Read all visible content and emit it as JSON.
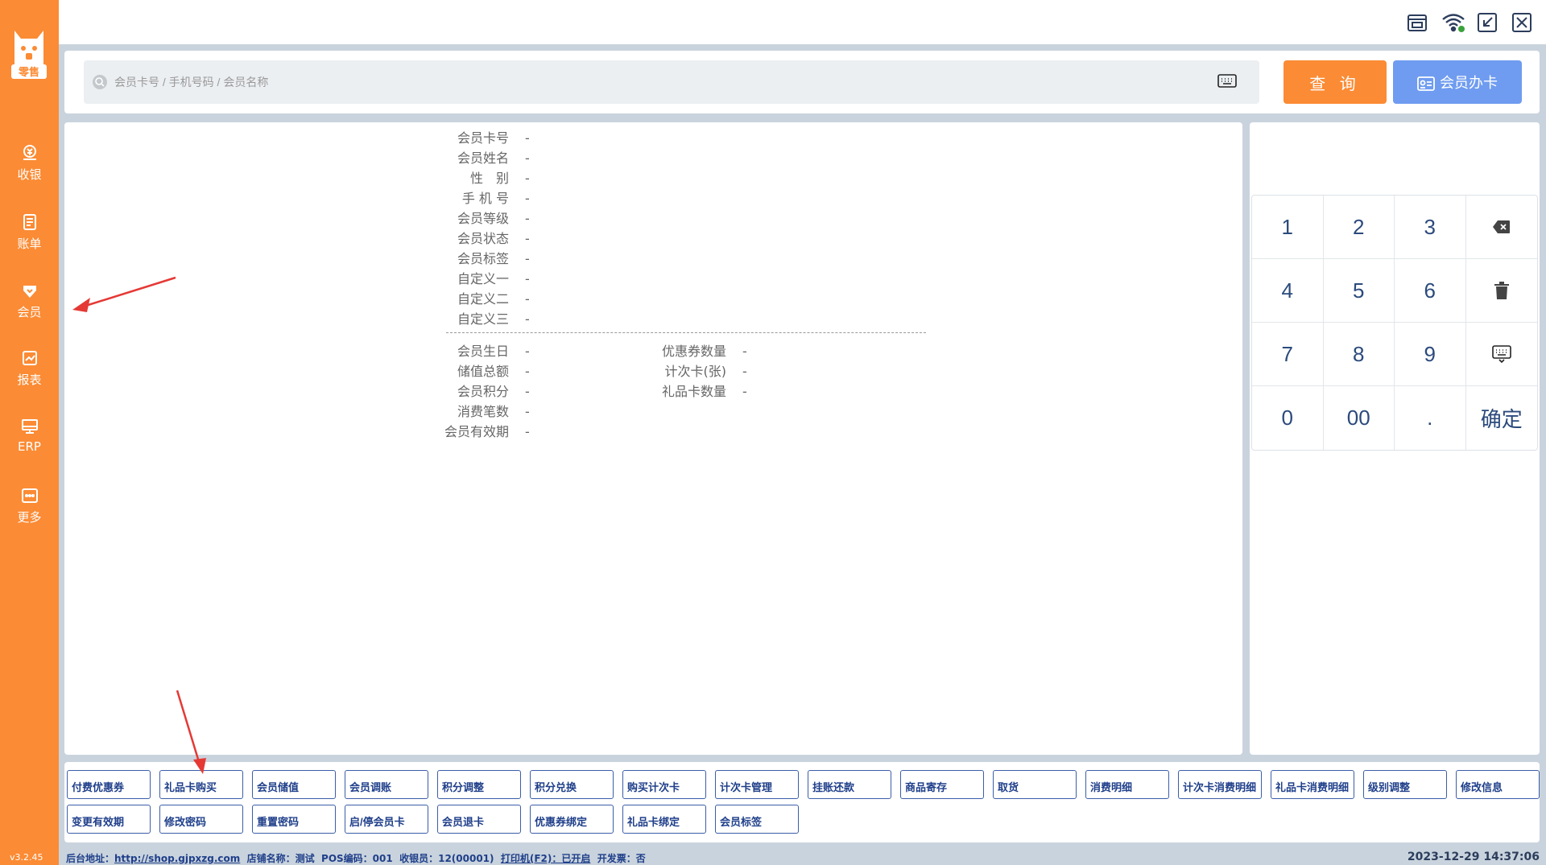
{
  "sidebar": {
    "logo_text": "零售",
    "items": [
      {
        "label": "收银",
        "icon": "cashier-icon"
      },
      {
        "label": "账单",
        "icon": "bill-icon"
      },
      {
        "label": "会员",
        "icon": "member-icon"
      },
      {
        "label": "报表",
        "icon": "report-icon"
      },
      {
        "label": "ERP",
        "icon": "erp-icon"
      },
      {
        "label": "更多",
        "icon": "more-icon"
      }
    ],
    "version": "v3.2.45"
  },
  "search": {
    "placeholder": "会员卡号 / 手机号码 / 会员名称",
    "query_label": "查 询",
    "card_label": "会员办卡"
  },
  "member": {
    "fields": [
      {
        "key": "会员卡号",
        "value": "-"
      },
      {
        "key": "会员姓名",
        "value": "-"
      },
      {
        "key": "性　别",
        "value": "-"
      },
      {
        "key": "手 机 号",
        "value": "-"
      },
      {
        "key": "会员等级",
        "value": "-"
      },
      {
        "key": "会员状态",
        "value": "-"
      },
      {
        "key": "会员标签",
        "value": "-"
      },
      {
        "key": "自定义一",
        "value": "-"
      },
      {
        "key": "自定义二",
        "value": "-"
      },
      {
        "key": "自定义三",
        "value": "-"
      }
    ],
    "stats_left": [
      {
        "key": "会员生日",
        "value": "-"
      },
      {
        "key": "储值总额",
        "value": "-"
      },
      {
        "key": "会员积分",
        "value": "-"
      },
      {
        "key": "消费笔数",
        "value": "-"
      },
      {
        "key": "会员有效期",
        "value": "-"
      }
    ],
    "stats_right": [
      {
        "key": "优惠券数量",
        "value": "-"
      },
      {
        "key": "计次卡(张)",
        "value": "-"
      },
      {
        "key": "礼品卡数量",
        "value": "-"
      }
    ]
  },
  "keypad": {
    "keys": [
      "1",
      "2",
      "3",
      "",
      "4",
      "5",
      "6",
      "",
      "7",
      "8",
      "9",
      "",
      "0",
      "00",
      ".",
      "确定"
    ],
    "icons": [
      "backspace-icon",
      "trash-icon",
      "keyboard-icon"
    ]
  },
  "functions": {
    "row1": [
      "付费优惠券",
      "礼品卡购买",
      "会员储值",
      "会员调账",
      "积分调整",
      "积分兑换",
      "购买计次卡",
      "计次卡管理",
      "挂账还款",
      "商品寄存",
      "取货",
      "消费明细",
      "计次卡消费明细",
      "礼品卡消费明细",
      "级别调整",
      "修改信息"
    ],
    "row2": [
      "变更有效期",
      "修改密码",
      "重置密码",
      "启/停会员卡",
      "会员退卡",
      "优惠券绑定",
      "礼品卡绑定",
      "会员标签"
    ]
  },
  "status": {
    "backend_label": "后台地址：",
    "backend_url": "http://shop.gjpxzg.com",
    "store": "店铺名称：测试",
    "pos": "POS编码：001",
    "cashier": "收银员：12(00001)",
    "printer": "打印机(F2)：已开启",
    "invoice": "开发票：否",
    "datetime": "2023-12-29 14:37:06"
  },
  "colors": {
    "brand": "#fb8b34",
    "accent_blue": "#6f9cf0",
    "button_border": "#3b5ea8",
    "background": "#c9d3dd"
  }
}
